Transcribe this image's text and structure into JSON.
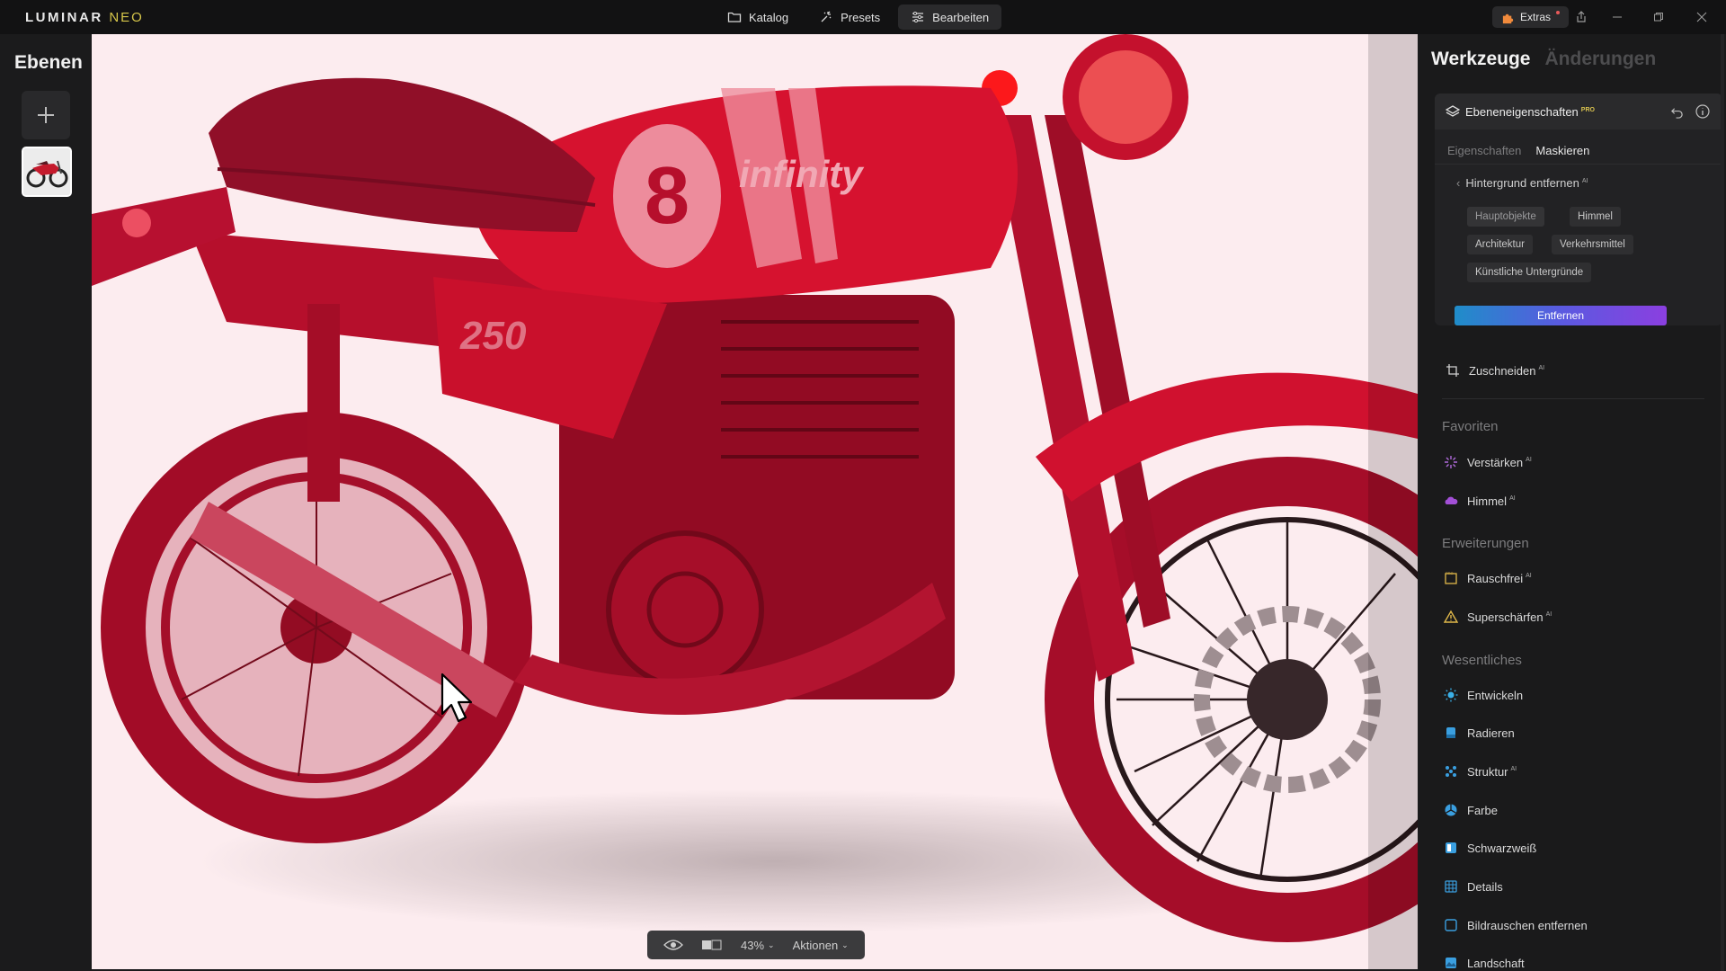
{
  "app": {
    "logo_main": "LUMINAR",
    "logo_sub": "NEO"
  },
  "topnav": [
    {
      "label": "Katalog",
      "icon": "folder-icon",
      "active": false
    },
    {
      "label": "Presets",
      "icon": "presets-icon",
      "active": false
    },
    {
      "label": "Bearbeiten",
      "icon": "sliders-icon",
      "active": true
    }
  ],
  "extras": {
    "label": "Extras"
  },
  "left": {
    "title": "Ebenen"
  },
  "bottom_toolbar": {
    "zoom": "43%",
    "actions": "Aktionen"
  },
  "right": {
    "tab_tools": "Werkzeuge",
    "tab_changes": "Änderungen",
    "props_title": "Ebeneneigenschaften",
    "pro_badge": "PRO",
    "ai_badge": "AI",
    "subtab_properties": "Eigenschaften",
    "subtab_masking": "Maskieren",
    "remove_bg_title": "Hintergrund entfernen",
    "chips": [
      "Hauptobjekte",
      "Himmel",
      "Architektur",
      "Verkehrsmittel",
      "Künstliche Untergründe"
    ],
    "remove_button": "Entfernen",
    "crop": "Zuschneiden",
    "section_favorites": "Favoriten",
    "favorites": [
      "Verstärken",
      "Himmel"
    ],
    "section_extensions": "Erweiterungen",
    "extensions": [
      "Rauschfrei",
      "Superschärfen"
    ],
    "section_essentials": "Wesentliches",
    "essentials": [
      "Entwickeln",
      "Radieren",
      "Struktur",
      "Farbe",
      "Schwarzweiß",
      "Details",
      "Bildrauschen entfernen",
      "Landschaft"
    ]
  },
  "colors": {
    "accent_gradient_start": "#1f8dc9",
    "accent_gradient_end": "#8b3fe0",
    "mask_overlay": "#d8102f",
    "pro_badge": "#d9c24f"
  }
}
